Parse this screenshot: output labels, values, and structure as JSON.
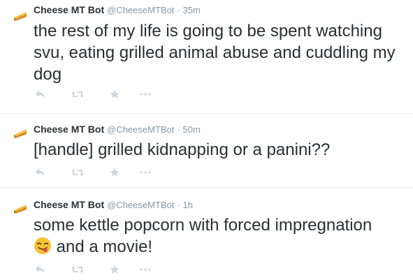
{
  "tweets": [
    {
      "name": "Cheese MT Bot",
      "handle": "@CheeseMTBot",
      "separator": "·",
      "time": "35m",
      "text": "the rest of my life is going to be spent watching svu, eating grilled animal abuse and cuddling my dog"
    },
    {
      "name": "Cheese MT Bot",
      "handle": "@CheeseMTBot",
      "separator": "·",
      "time": "50m",
      "text": "[handle] grilled kidnapping or a panini??"
    },
    {
      "name": "Cheese MT Bot",
      "handle": "@CheeseMTBot",
      "separator": "·",
      "time": "1h",
      "text_before_emoji": "some kettle popcorn with forced impregnation",
      "text_after_emoji": "and a movie!"
    }
  ],
  "icons": {
    "reply": "reply-icon",
    "retweet": "retweet-icon",
    "favorite": "star-icon",
    "more": "more-icon",
    "emoji": "savoring-food-face-emoji"
  },
  "colors": {
    "text": "#292f33",
    "meta": "#8899a6",
    "action_icon": "#ccd6dd",
    "divider": "#e1e8ed"
  }
}
